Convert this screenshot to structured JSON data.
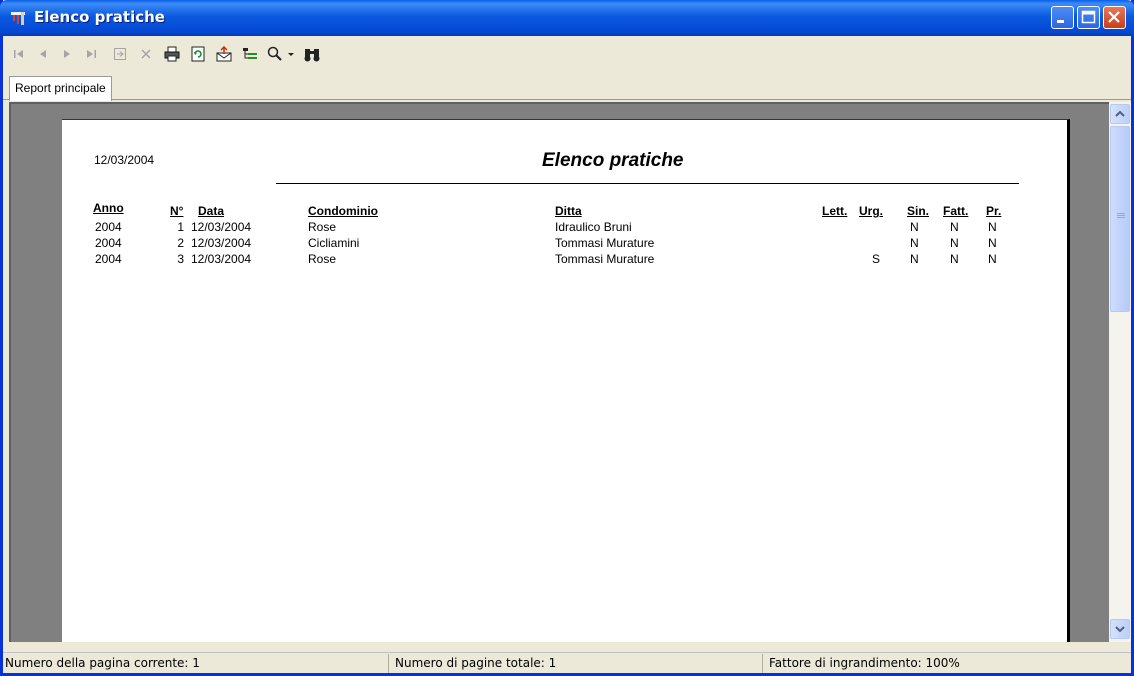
{
  "window": {
    "title": "Elenco pratiche"
  },
  "toolbar": {
    "tools": [
      {
        "name": "first-page-icon",
        "glyph": "⏮",
        "enabled": false
      },
      {
        "name": "prev-page-icon",
        "glyph": "◀",
        "enabled": false
      },
      {
        "name": "next-page-icon",
        "glyph": "▶",
        "enabled": false
      },
      {
        "name": "last-page-icon",
        "glyph": "⏭",
        "enabled": false
      },
      {
        "name": "goto-page-icon",
        "glyph": "⇥",
        "enabled": false
      },
      {
        "name": "stop-icon",
        "glyph": "✕",
        "enabled": false
      },
      {
        "name": "print-icon",
        "glyph": "🖶",
        "enabled": true
      },
      {
        "name": "refresh-icon",
        "glyph": "⟳",
        "enabled": true
      },
      {
        "name": "export-icon",
        "glyph": "✉",
        "enabled": true
      },
      {
        "name": "group-tree-icon",
        "glyph": "☷",
        "enabled": true
      },
      {
        "name": "zoom-icon",
        "glyph": "🔍",
        "enabled": true
      },
      {
        "name": "dropdown-arrow-icon",
        "glyph": "▾",
        "enabled": true
      },
      {
        "name": "search-binoculars-icon",
        "glyph": "👓",
        "enabled": true
      }
    ]
  },
  "tabs": [
    {
      "label": "Report principale"
    }
  ],
  "report": {
    "date": "12/03/2004",
    "title": "Elenco pratiche",
    "headers": {
      "anno": "Anno",
      "numero": "N°",
      "data": "Data",
      "condominio": "Condominio",
      "ditta": "Ditta",
      "lett": "Lett.",
      "urg": "Urg.",
      "sin": "Sin.",
      "fatt": "Fatt.",
      "pr": "Pr."
    },
    "rows": [
      {
        "anno": "2004",
        "numero": "1",
        "data": "12/03/2004",
        "condominio": "Rose",
        "ditta": "Idraulico Bruni",
        "lett": "",
        "urg": "",
        "sin": "N",
        "fatt": "N",
        "pr": "N"
      },
      {
        "anno": "2004",
        "numero": "2",
        "data": "12/03/2004",
        "condominio": "Cicliamini",
        "ditta": "Tommasi Murature",
        "lett": "",
        "urg": "",
        "sin": "N",
        "fatt": "N",
        "pr": "N"
      },
      {
        "anno": "2004",
        "numero": "3",
        "data": "12/03/2004",
        "condominio": "Rose",
        "ditta": "Tommasi Murature",
        "lett": "",
        "urg": "S",
        "sin": "N",
        "fatt": "N",
        "pr": "N"
      }
    ]
  },
  "status": {
    "current_page": "Numero della pagina corrente: 1",
    "total_pages": "Numero di pagine totale: 1",
    "zoom": "Fattore di ingrandimento: 100%"
  }
}
